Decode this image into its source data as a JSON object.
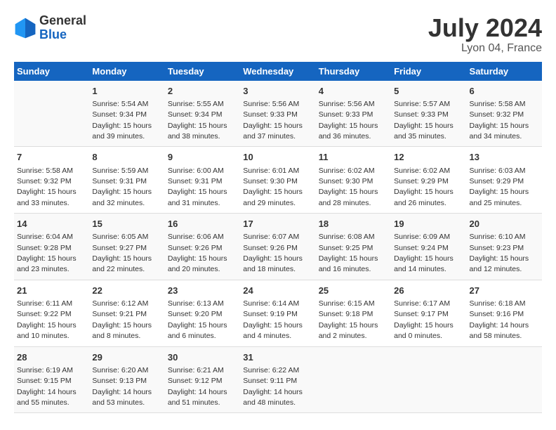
{
  "header": {
    "logo_general": "General",
    "logo_blue": "Blue",
    "month_year": "July 2024",
    "location": "Lyon 04, France"
  },
  "weekdays": [
    "Sunday",
    "Monday",
    "Tuesday",
    "Wednesday",
    "Thursday",
    "Friday",
    "Saturday"
  ],
  "weeks": [
    [
      {
        "day": "",
        "info": ""
      },
      {
        "day": "1",
        "info": "Sunrise: 5:54 AM\nSunset: 9:34 PM\nDaylight: 15 hours\nand 39 minutes."
      },
      {
        "day": "2",
        "info": "Sunrise: 5:55 AM\nSunset: 9:34 PM\nDaylight: 15 hours\nand 38 minutes."
      },
      {
        "day": "3",
        "info": "Sunrise: 5:56 AM\nSunset: 9:33 PM\nDaylight: 15 hours\nand 37 minutes."
      },
      {
        "day": "4",
        "info": "Sunrise: 5:56 AM\nSunset: 9:33 PM\nDaylight: 15 hours\nand 36 minutes."
      },
      {
        "day": "5",
        "info": "Sunrise: 5:57 AM\nSunset: 9:33 PM\nDaylight: 15 hours\nand 35 minutes."
      },
      {
        "day": "6",
        "info": "Sunrise: 5:58 AM\nSunset: 9:32 PM\nDaylight: 15 hours\nand 34 minutes."
      }
    ],
    [
      {
        "day": "7",
        "info": "Sunrise: 5:58 AM\nSunset: 9:32 PM\nDaylight: 15 hours\nand 33 minutes."
      },
      {
        "day": "8",
        "info": "Sunrise: 5:59 AM\nSunset: 9:31 PM\nDaylight: 15 hours\nand 32 minutes."
      },
      {
        "day": "9",
        "info": "Sunrise: 6:00 AM\nSunset: 9:31 PM\nDaylight: 15 hours\nand 31 minutes."
      },
      {
        "day": "10",
        "info": "Sunrise: 6:01 AM\nSunset: 9:30 PM\nDaylight: 15 hours\nand 29 minutes."
      },
      {
        "day": "11",
        "info": "Sunrise: 6:02 AM\nSunset: 9:30 PM\nDaylight: 15 hours\nand 28 minutes."
      },
      {
        "day": "12",
        "info": "Sunrise: 6:02 AM\nSunset: 9:29 PM\nDaylight: 15 hours\nand 26 minutes."
      },
      {
        "day": "13",
        "info": "Sunrise: 6:03 AM\nSunset: 9:29 PM\nDaylight: 15 hours\nand 25 minutes."
      }
    ],
    [
      {
        "day": "14",
        "info": "Sunrise: 6:04 AM\nSunset: 9:28 PM\nDaylight: 15 hours\nand 23 minutes."
      },
      {
        "day": "15",
        "info": "Sunrise: 6:05 AM\nSunset: 9:27 PM\nDaylight: 15 hours\nand 22 minutes."
      },
      {
        "day": "16",
        "info": "Sunrise: 6:06 AM\nSunset: 9:26 PM\nDaylight: 15 hours\nand 20 minutes."
      },
      {
        "day": "17",
        "info": "Sunrise: 6:07 AM\nSunset: 9:26 PM\nDaylight: 15 hours\nand 18 minutes."
      },
      {
        "day": "18",
        "info": "Sunrise: 6:08 AM\nSunset: 9:25 PM\nDaylight: 15 hours\nand 16 minutes."
      },
      {
        "day": "19",
        "info": "Sunrise: 6:09 AM\nSunset: 9:24 PM\nDaylight: 15 hours\nand 14 minutes."
      },
      {
        "day": "20",
        "info": "Sunrise: 6:10 AM\nSunset: 9:23 PM\nDaylight: 15 hours\nand 12 minutes."
      }
    ],
    [
      {
        "day": "21",
        "info": "Sunrise: 6:11 AM\nSunset: 9:22 PM\nDaylight: 15 hours\nand 10 minutes."
      },
      {
        "day": "22",
        "info": "Sunrise: 6:12 AM\nSunset: 9:21 PM\nDaylight: 15 hours\nand 8 minutes."
      },
      {
        "day": "23",
        "info": "Sunrise: 6:13 AM\nSunset: 9:20 PM\nDaylight: 15 hours\nand 6 minutes."
      },
      {
        "day": "24",
        "info": "Sunrise: 6:14 AM\nSunset: 9:19 PM\nDaylight: 15 hours\nand 4 minutes."
      },
      {
        "day": "25",
        "info": "Sunrise: 6:15 AM\nSunset: 9:18 PM\nDaylight: 15 hours\nand 2 minutes."
      },
      {
        "day": "26",
        "info": "Sunrise: 6:17 AM\nSunset: 9:17 PM\nDaylight: 15 hours\nand 0 minutes."
      },
      {
        "day": "27",
        "info": "Sunrise: 6:18 AM\nSunset: 9:16 PM\nDaylight: 14 hours\nand 58 minutes."
      }
    ],
    [
      {
        "day": "28",
        "info": "Sunrise: 6:19 AM\nSunset: 9:15 PM\nDaylight: 14 hours\nand 55 minutes."
      },
      {
        "day": "29",
        "info": "Sunrise: 6:20 AM\nSunset: 9:13 PM\nDaylight: 14 hours\nand 53 minutes."
      },
      {
        "day": "30",
        "info": "Sunrise: 6:21 AM\nSunset: 9:12 PM\nDaylight: 14 hours\nand 51 minutes."
      },
      {
        "day": "31",
        "info": "Sunrise: 6:22 AM\nSunset: 9:11 PM\nDaylight: 14 hours\nand 48 minutes."
      },
      {
        "day": "",
        "info": ""
      },
      {
        "day": "",
        "info": ""
      },
      {
        "day": "",
        "info": ""
      }
    ]
  ]
}
